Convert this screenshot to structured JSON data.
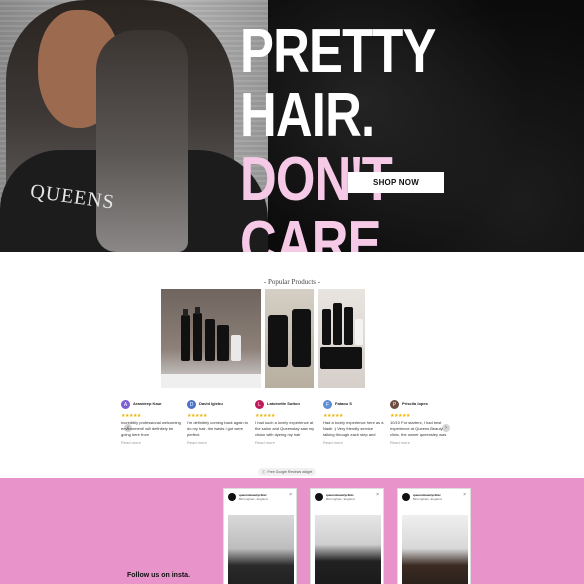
{
  "hero": {
    "line1": "PRETTY HAIR.",
    "line2": "DON'T CARE.",
    "cape_text": "QUEENS",
    "shop_button": "SHOP NOW",
    "colors": {
      "line1": "#ffffff",
      "line2": "#f6c9e6",
      "background": "#0b0b0b"
    }
  },
  "popular": {
    "title": "- Popular Products -",
    "products": [
      {
        "label": "Product photo 1"
      },
      {
        "label": "Product photo 2"
      },
      {
        "label": "Product photo 3"
      }
    ]
  },
  "reviews": {
    "items": [
      {
        "initial": "A",
        "name": "Arandeep Kaur",
        "color": "#7c5fd3",
        "stars": "★★★★★",
        "text": "Incredibly professional welcoming environment! will definitely be going here from",
        "more": "Read more"
      },
      {
        "initial": "D",
        "name": "David Igiebu",
        "color": "#4a73c8",
        "stars": "★★★★★",
        "text": "I'm definitely coming back again to do my hair, the twists I got were perfect.",
        "more": "Read more"
      },
      {
        "initial": "L",
        "name": "Latoinette Sutton",
        "color": "#c2185b",
        "stars": "★★★★★",
        "text": "I had such a lovely experience at the salon and Queenstay saw my vision with dyeing my hair",
        "more": "Read more"
      },
      {
        "initial": "F",
        "name": "Fataou S",
        "color": "#5c8fd6",
        "stars": "★★★★★",
        "text": "Had a lovely experience here as a Nadir :) Very friendly service talking through each step and",
        "more": "Read more"
      },
      {
        "initial": "P",
        "name": "Priscila lopes",
        "color": "#6d4c41",
        "stars": "★★★★★",
        "text": "10/10 For starters, I had best experience at Queens Beauty clinic, the owner queensley was",
        "more": "Read more"
      }
    ],
    "free_badge": "Free Google Reviews widget",
    "prev": "‹",
    "next": "›"
  },
  "insta": {
    "title": "Follow us on insta.",
    "cards": [
      {
        "user": "queensbeautyclinic",
        "location": "Birmingham, England"
      },
      {
        "user": "queensbeautyclinic",
        "location": "Birmingham, England"
      },
      {
        "user": "queensbeautyclinic",
        "location": "Birmingham, England"
      }
    ],
    "background": "#e893c9"
  }
}
